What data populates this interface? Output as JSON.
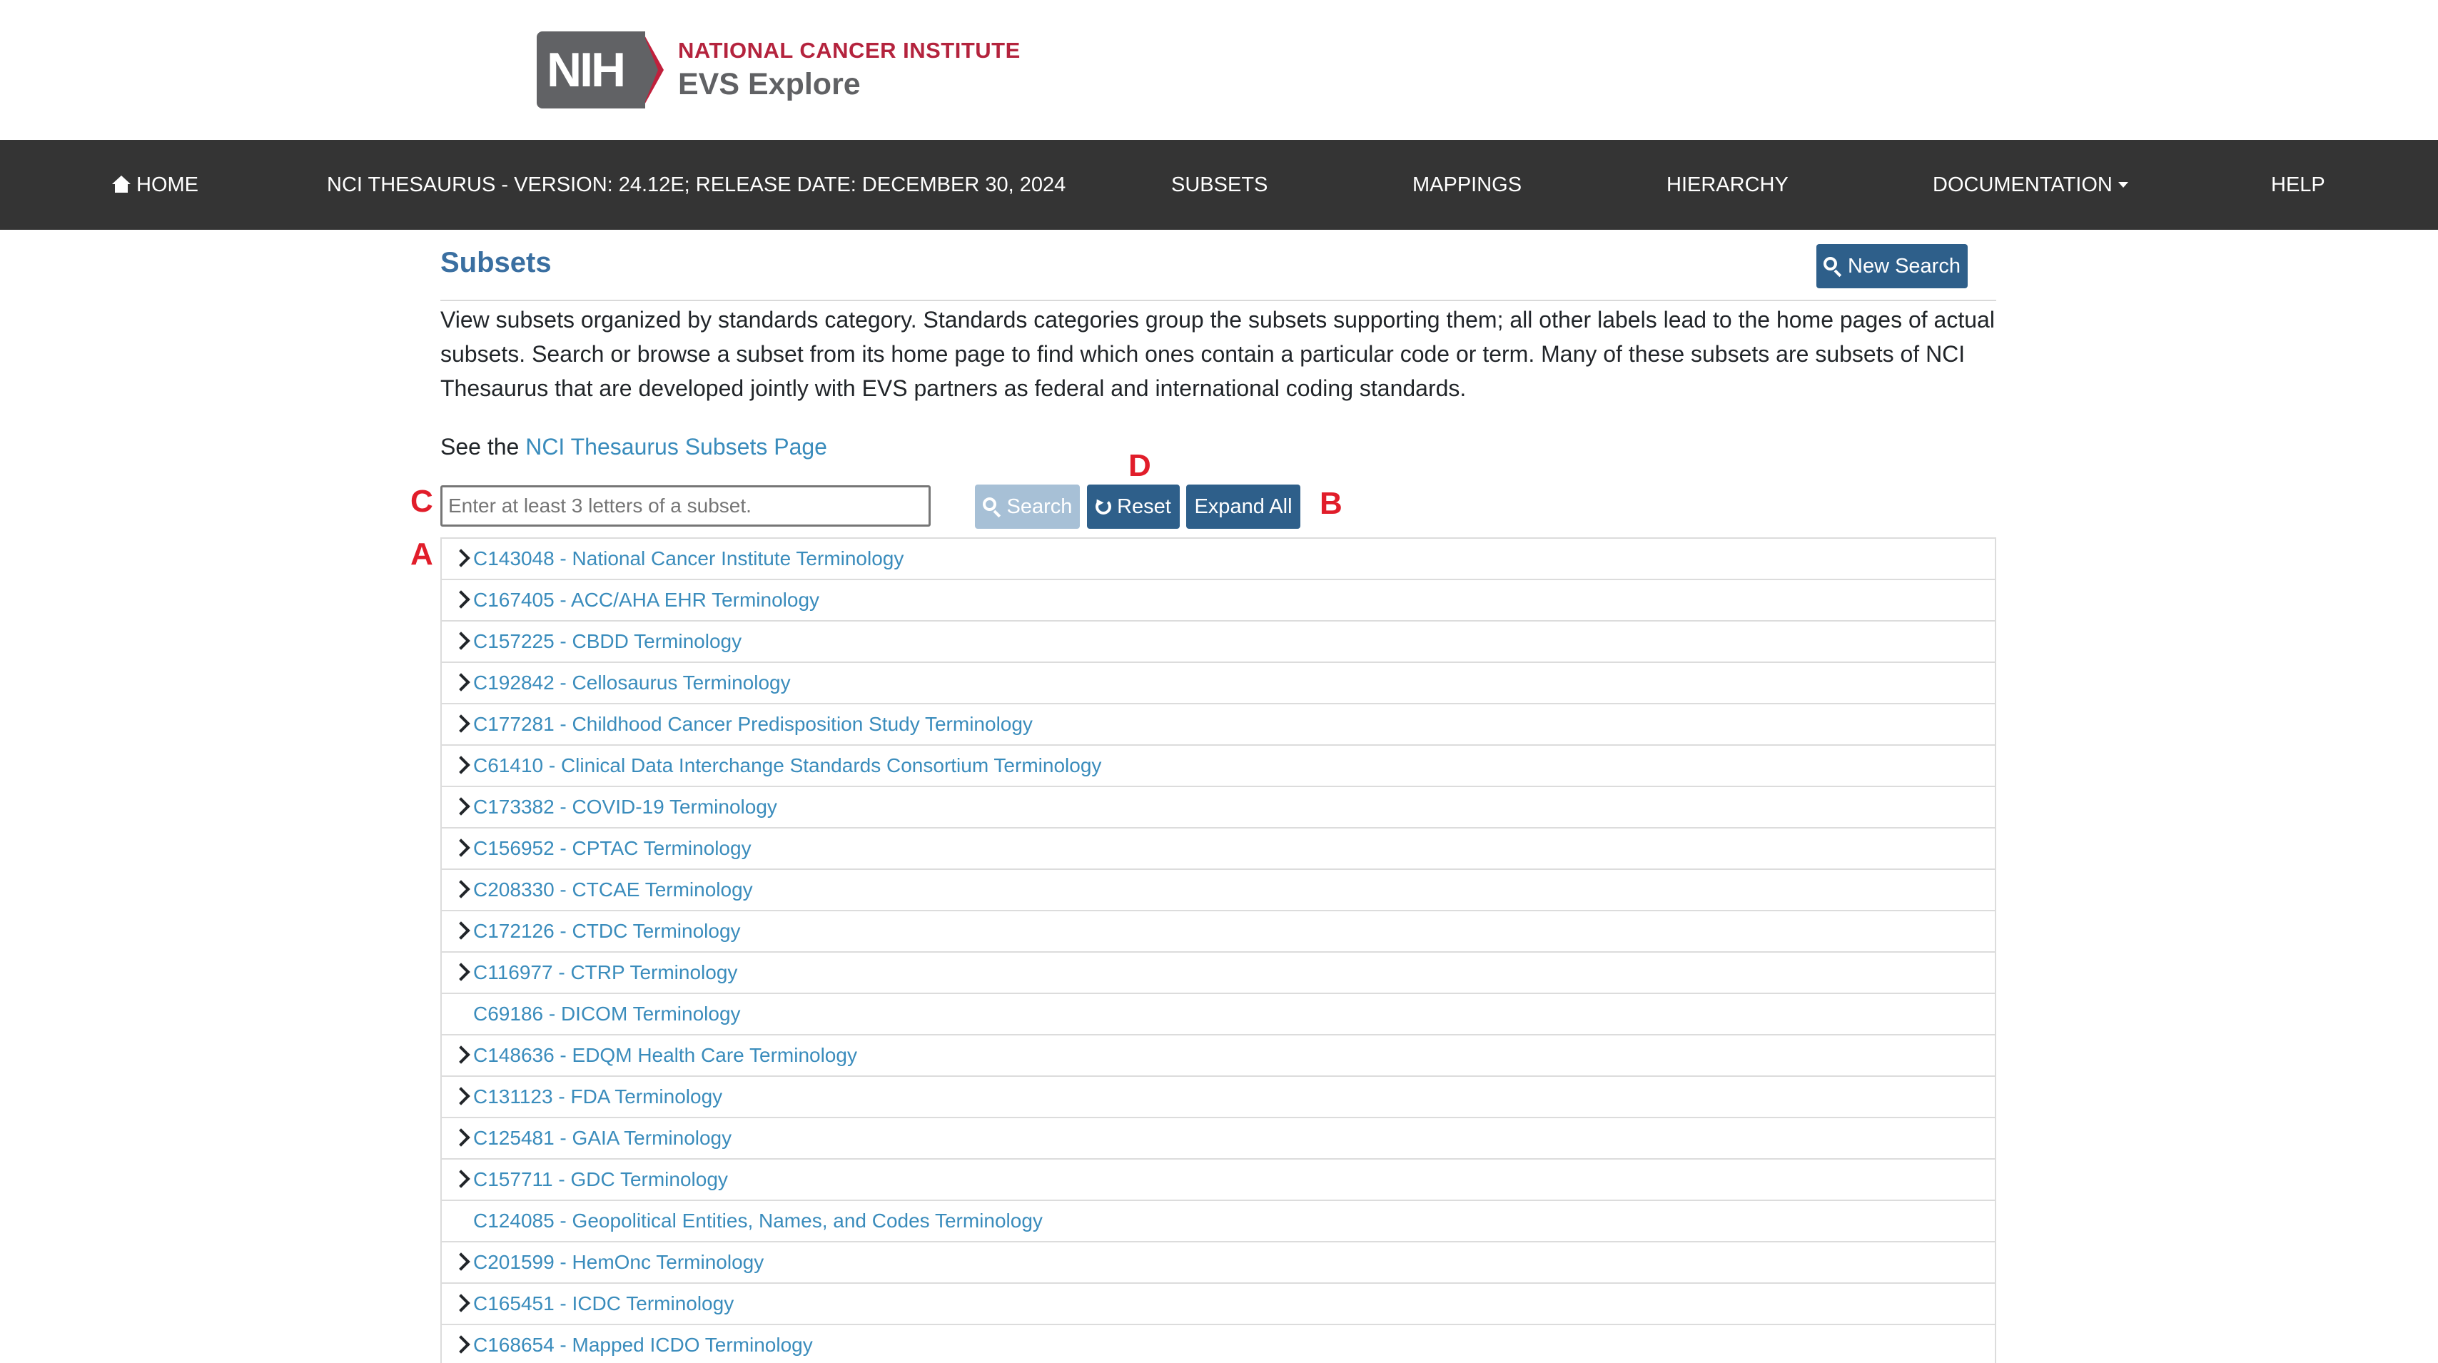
{
  "header": {
    "logo_mark": "NIH",
    "org_name": "NATIONAL CANCER INSTITUTE",
    "app_name": "EVS Explore"
  },
  "nav": {
    "home": "HOME",
    "version": "NCI THESAURUS - VERSION: 24.12E; RELEASE DATE: DECEMBER 30, 2024",
    "subsets": "SUBSETS",
    "mappings": "MAPPINGS",
    "hierarchy": "HIERARCHY",
    "documentation": "DOCUMENTATION",
    "help": "HELP"
  },
  "page": {
    "title": "Subsets",
    "new_search": "New Search",
    "description": "View subsets organized by standards category. Standards categories group the subsets supporting them; all other labels lead to the home pages of actual subsets. Search or browse a subset from its home page to find which ones contain a particular code or term. Many of these subsets are subsets of NCI Thesaurus that are developed jointly with EVS partners as federal and international coding standards.",
    "see_prefix": "See the ",
    "see_link": "NCI Thesaurus Subsets Page"
  },
  "toolbar": {
    "search_placeholder": "Enter at least 3 letters of a subset.",
    "search_value": "",
    "search_button": "Search",
    "reset_button": "Reset",
    "expand_button": "Expand All"
  },
  "annotations": {
    "a": "A",
    "b": "B",
    "c": "C",
    "d": "D"
  },
  "subsets": [
    {
      "label": "C143048 - National Cancer Institute Terminology",
      "expandable": true
    },
    {
      "label": "C167405 - ACC/AHA EHR Terminology",
      "expandable": true
    },
    {
      "label": "C157225 - CBDD Terminology",
      "expandable": true
    },
    {
      "label": "C192842 - Cellosaurus Terminology",
      "expandable": true
    },
    {
      "label": "C177281 - Childhood Cancer Predisposition Study Terminology",
      "expandable": true
    },
    {
      "label": "C61410 - Clinical Data Interchange Standards Consortium Terminology",
      "expandable": true
    },
    {
      "label": "C173382 - COVID-19 Terminology",
      "expandable": true
    },
    {
      "label": "C156952 - CPTAC Terminology",
      "expandable": true
    },
    {
      "label": "C208330 - CTCAE Terminology",
      "expandable": true
    },
    {
      "label": "C172126 - CTDC Terminology",
      "expandable": true
    },
    {
      "label": "C116977 - CTRP Terminology",
      "expandable": true
    },
    {
      "label": "C69186 - DICOM Terminology",
      "expandable": false
    },
    {
      "label": "C148636 - EDQM Health Care Terminology",
      "expandable": true
    },
    {
      "label": "C131123 - FDA Terminology",
      "expandable": true
    },
    {
      "label": "C125481 - GAIA Terminology",
      "expandable": true
    },
    {
      "label": "C157711 - GDC Terminology",
      "expandable": true
    },
    {
      "label": "C124085 - Geopolitical Entities, Names, and Codes Terminology",
      "expandable": false
    },
    {
      "label": "C201599 - HemOnc Terminology",
      "expandable": true
    },
    {
      "label": "C165451 - ICDC Terminology",
      "expandable": true
    },
    {
      "label": "C168654 - Mapped ICDO Terminology",
      "expandable": true
    }
  ]
}
